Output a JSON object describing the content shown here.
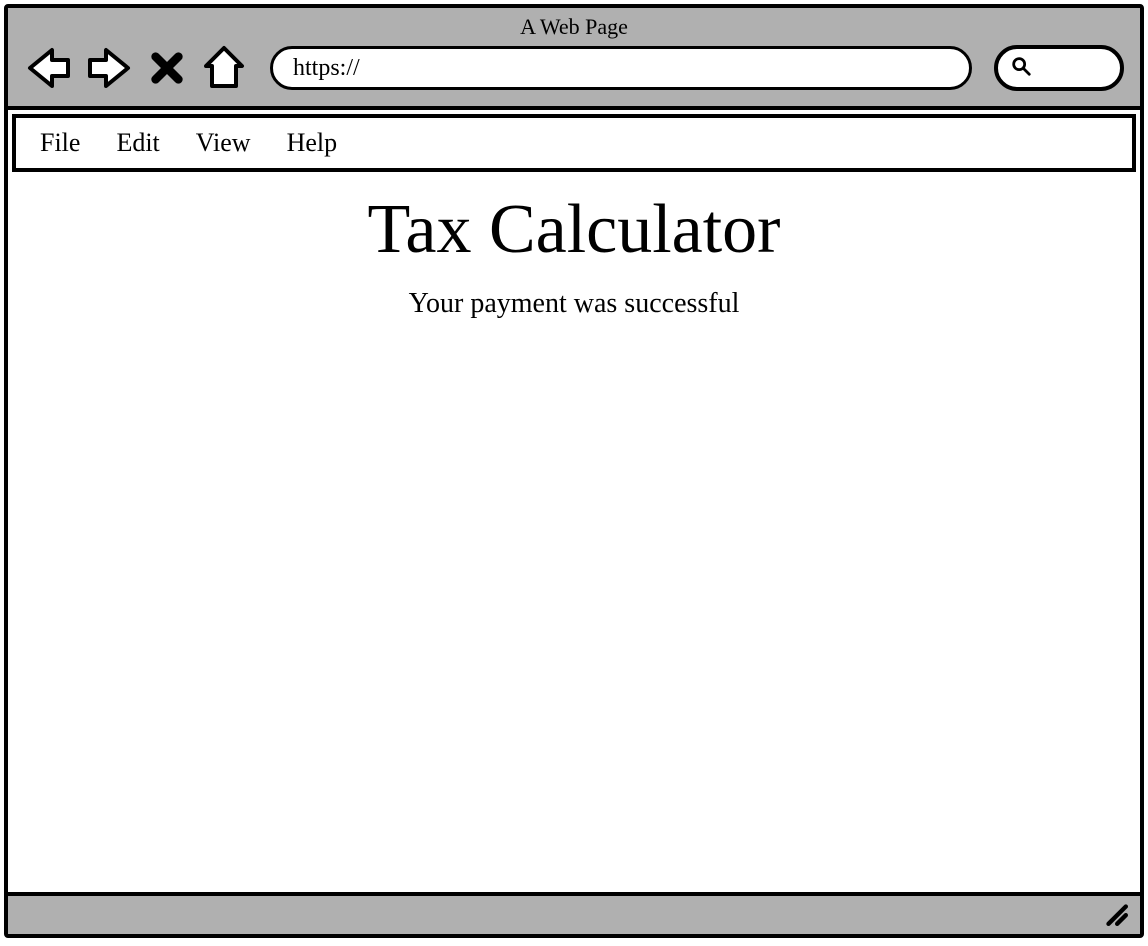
{
  "browser": {
    "title": "A Web Page",
    "address": "https://"
  },
  "menu": {
    "items": [
      "File",
      "Edit",
      "View",
      "Help"
    ]
  },
  "page": {
    "heading": "Tax Calculator",
    "message": "Your payment was successful"
  }
}
